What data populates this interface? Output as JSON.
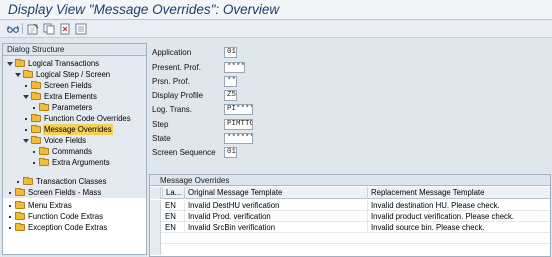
{
  "window": {
    "title": "Display View \"Message Overrides\": Overview"
  },
  "toolbar": {
    "icons": [
      "glasses-icon",
      "display-change-icon",
      "copy-icon",
      "delete-icon",
      "select-all-icon"
    ]
  },
  "tree": {
    "header": "Dialog Structure",
    "nodes": [
      {
        "label": "Logical Transactions"
      },
      {
        "label": "Logical Step / Screen"
      },
      {
        "label": "Screen Fields"
      },
      {
        "label": "Extra Elements"
      },
      {
        "label": "Parameters"
      },
      {
        "label": "Function Code Overrides"
      },
      {
        "label": "Message Overrides"
      },
      {
        "label": "Voice Fields"
      },
      {
        "label": "Commands"
      },
      {
        "label": "Extra Arguments"
      },
      {
        "label": "Transaction Classes"
      },
      {
        "label": "Screen Fields - Mass"
      },
      {
        "label": "Menu Extras"
      },
      {
        "label": "Function Code Extras"
      },
      {
        "label": "Exception Code Extras"
      }
    ]
  },
  "form": {
    "application": {
      "label": "Application",
      "value": "01"
    },
    "presentation_profile": {
      "label": "Present. Prof.",
      "value": "****"
    },
    "personalization_profile": {
      "label": "Prsn. Prof.",
      "value": "**"
    },
    "display_profile": {
      "label": "Display Profile",
      "value": "Z5"
    },
    "logical_transaction": {
      "label": "Log. Trans.",
      "value": "PI****"
    },
    "step": {
      "label": "Step",
      "value": "PIMTTO"
    },
    "state": {
      "label": "State",
      "value": "******"
    },
    "screen_sequence": {
      "label": "Screen Sequence",
      "value": "01"
    }
  },
  "table": {
    "caption": "Message Overrides",
    "columns": [
      "La...",
      "Original Message Template",
      "Replacement Message Template"
    ],
    "rows": [
      {
        "lang": "EN",
        "original": "Invalid DestHU verification",
        "replacement": "Invalid destination HU. Please check."
      },
      {
        "lang": "EN",
        "original": "Invalid Prod. verification",
        "replacement": "Invalid product verification. Please check."
      },
      {
        "lang": "EN",
        "original": "Invalid SrcBin verification",
        "replacement": "Invalid source bin. Please check."
      }
    ]
  }
}
